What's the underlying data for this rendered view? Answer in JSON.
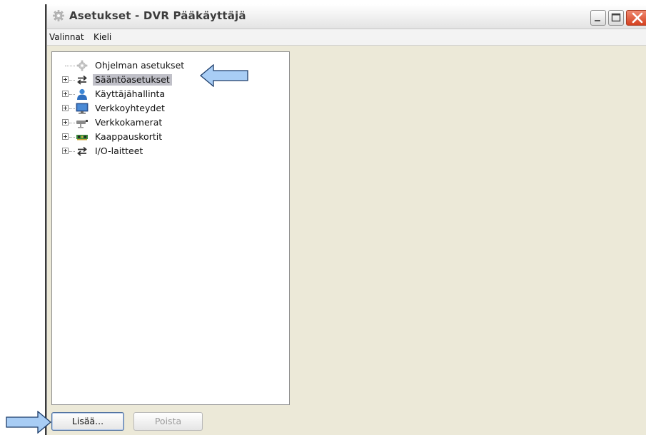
{
  "window": {
    "title": "Asetukset - DVR Pääkäyttäjä",
    "title_icon": "gear-icon"
  },
  "menubar": {
    "items": [
      {
        "label": "Valinnat"
      },
      {
        "label": "Kieli"
      }
    ]
  },
  "tree": {
    "items": [
      {
        "label": "Ohjelman asetukset",
        "icon": "gear-icon",
        "expandable": false,
        "selected": false
      },
      {
        "label": "Sääntöasetukset",
        "icon": "transfer-arrows-icon",
        "expandable": true,
        "selected": true
      },
      {
        "label": "Käyttäjähallinta",
        "icon": "user-icon",
        "expandable": true,
        "selected": false
      },
      {
        "label": "Verkkoyhteydet",
        "icon": "monitor-icon",
        "expandable": true,
        "selected": false
      },
      {
        "label": "Verkkokamerat",
        "icon": "camera-icon",
        "expandable": true,
        "selected": false
      },
      {
        "label": "Kaappauskortit",
        "icon": "capture-card-icon",
        "expandable": true,
        "selected": false
      },
      {
        "label": "I/O-laitteet",
        "icon": "transfer-arrows-icon",
        "expandable": true,
        "selected": false
      }
    ]
  },
  "buttons": {
    "add_label": "Lisää...",
    "delete_label": "Poista"
  },
  "colors": {
    "window_bg": "#ece9d8",
    "selection": "#c0c0c8",
    "arrow_fill": "#a8cdf5",
    "arrow_stroke": "#1d3d6a",
    "close_button": "#d4401f"
  }
}
